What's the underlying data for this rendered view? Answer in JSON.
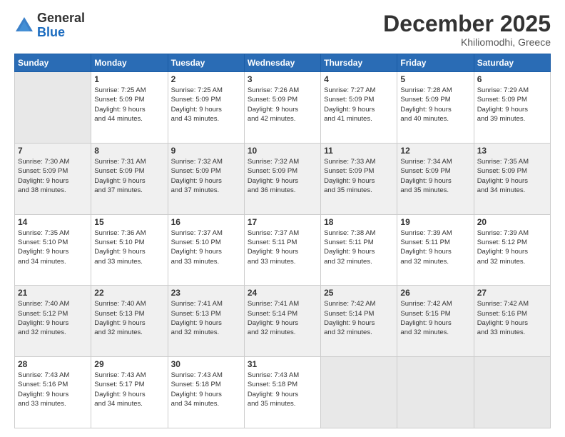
{
  "header": {
    "logo_general": "General",
    "logo_blue": "Blue",
    "month_title": "December 2025",
    "location": "Khiliomodhi, Greece"
  },
  "weekdays": [
    "Sunday",
    "Monday",
    "Tuesday",
    "Wednesday",
    "Thursday",
    "Friday",
    "Saturday"
  ],
  "weeks": [
    [
      {
        "day": "",
        "info": ""
      },
      {
        "day": "1",
        "info": "Sunrise: 7:25 AM\nSunset: 5:09 PM\nDaylight: 9 hours\nand 44 minutes."
      },
      {
        "day": "2",
        "info": "Sunrise: 7:25 AM\nSunset: 5:09 PM\nDaylight: 9 hours\nand 43 minutes."
      },
      {
        "day": "3",
        "info": "Sunrise: 7:26 AM\nSunset: 5:09 PM\nDaylight: 9 hours\nand 42 minutes."
      },
      {
        "day": "4",
        "info": "Sunrise: 7:27 AM\nSunset: 5:09 PM\nDaylight: 9 hours\nand 41 minutes."
      },
      {
        "day": "5",
        "info": "Sunrise: 7:28 AM\nSunset: 5:09 PM\nDaylight: 9 hours\nand 40 minutes."
      },
      {
        "day": "6",
        "info": "Sunrise: 7:29 AM\nSunset: 5:09 PM\nDaylight: 9 hours\nand 39 minutes."
      }
    ],
    [
      {
        "day": "7",
        "info": "Sunrise: 7:30 AM\nSunset: 5:09 PM\nDaylight: 9 hours\nand 38 minutes."
      },
      {
        "day": "8",
        "info": "Sunrise: 7:31 AM\nSunset: 5:09 PM\nDaylight: 9 hours\nand 37 minutes."
      },
      {
        "day": "9",
        "info": "Sunrise: 7:32 AM\nSunset: 5:09 PM\nDaylight: 9 hours\nand 37 minutes."
      },
      {
        "day": "10",
        "info": "Sunrise: 7:32 AM\nSunset: 5:09 PM\nDaylight: 9 hours\nand 36 minutes."
      },
      {
        "day": "11",
        "info": "Sunrise: 7:33 AM\nSunset: 5:09 PM\nDaylight: 9 hours\nand 35 minutes."
      },
      {
        "day": "12",
        "info": "Sunrise: 7:34 AM\nSunset: 5:09 PM\nDaylight: 9 hours\nand 35 minutes."
      },
      {
        "day": "13",
        "info": "Sunrise: 7:35 AM\nSunset: 5:09 PM\nDaylight: 9 hours\nand 34 minutes."
      }
    ],
    [
      {
        "day": "14",
        "info": "Sunrise: 7:35 AM\nSunset: 5:10 PM\nDaylight: 9 hours\nand 34 minutes."
      },
      {
        "day": "15",
        "info": "Sunrise: 7:36 AM\nSunset: 5:10 PM\nDaylight: 9 hours\nand 33 minutes."
      },
      {
        "day": "16",
        "info": "Sunrise: 7:37 AM\nSunset: 5:10 PM\nDaylight: 9 hours\nand 33 minutes."
      },
      {
        "day": "17",
        "info": "Sunrise: 7:37 AM\nSunset: 5:11 PM\nDaylight: 9 hours\nand 33 minutes."
      },
      {
        "day": "18",
        "info": "Sunrise: 7:38 AM\nSunset: 5:11 PM\nDaylight: 9 hours\nand 32 minutes."
      },
      {
        "day": "19",
        "info": "Sunrise: 7:39 AM\nSunset: 5:11 PM\nDaylight: 9 hours\nand 32 minutes."
      },
      {
        "day": "20",
        "info": "Sunrise: 7:39 AM\nSunset: 5:12 PM\nDaylight: 9 hours\nand 32 minutes."
      }
    ],
    [
      {
        "day": "21",
        "info": "Sunrise: 7:40 AM\nSunset: 5:12 PM\nDaylight: 9 hours\nand 32 minutes."
      },
      {
        "day": "22",
        "info": "Sunrise: 7:40 AM\nSunset: 5:13 PM\nDaylight: 9 hours\nand 32 minutes."
      },
      {
        "day": "23",
        "info": "Sunrise: 7:41 AM\nSunset: 5:13 PM\nDaylight: 9 hours\nand 32 minutes."
      },
      {
        "day": "24",
        "info": "Sunrise: 7:41 AM\nSunset: 5:14 PM\nDaylight: 9 hours\nand 32 minutes."
      },
      {
        "day": "25",
        "info": "Sunrise: 7:42 AM\nSunset: 5:14 PM\nDaylight: 9 hours\nand 32 minutes."
      },
      {
        "day": "26",
        "info": "Sunrise: 7:42 AM\nSunset: 5:15 PM\nDaylight: 9 hours\nand 32 minutes."
      },
      {
        "day": "27",
        "info": "Sunrise: 7:42 AM\nSunset: 5:16 PM\nDaylight: 9 hours\nand 33 minutes."
      }
    ],
    [
      {
        "day": "28",
        "info": "Sunrise: 7:43 AM\nSunset: 5:16 PM\nDaylight: 9 hours\nand 33 minutes."
      },
      {
        "day": "29",
        "info": "Sunrise: 7:43 AM\nSunset: 5:17 PM\nDaylight: 9 hours\nand 34 minutes."
      },
      {
        "day": "30",
        "info": "Sunrise: 7:43 AM\nSunset: 5:18 PM\nDaylight: 9 hours\nand 34 minutes."
      },
      {
        "day": "31",
        "info": "Sunrise: 7:43 AM\nSunset: 5:18 PM\nDaylight: 9 hours\nand 35 minutes."
      },
      {
        "day": "",
        "info": ""
      },
      {
        "day": "",
        "info": ""
      },
      {
        "day": "",
        "info": ""
      }
    ]
  ]
}
